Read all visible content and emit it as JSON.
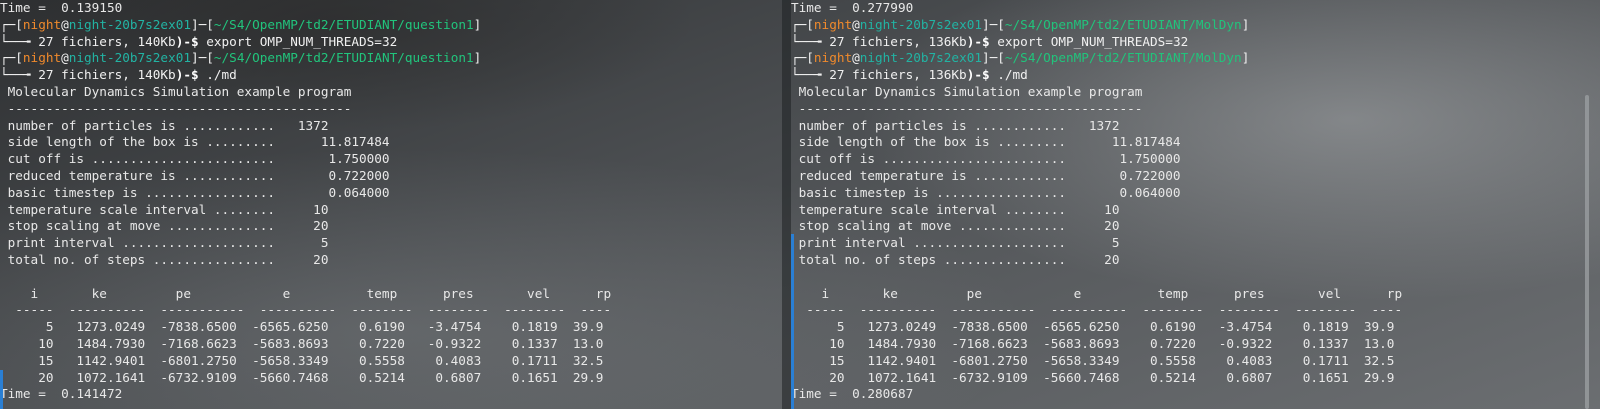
{
  "left": {
    "time_top": "Time =  0.139150",
    "prompt1": {
      "user": "night",
      "host": "night-20b7s2ex01",
      "path": "~/S4/OpenMP/td2/ETUDIANT/question1",
      "files": "27 fichiers, 140Kb",
      "cmd": " export OMP_NUM_THREADS=32"
    },
    "prompt2": {
      "user": "night",
      "host": "night-20b7s2ex01",
      "path": "~/S4/OpenMP/td2/ETUDIANT/question1",
      "files": "27 fichiers, 140Kb",
      "cmd": " ./md"
    },
    "time_bottom": "Time =  0.141472"
  },
  "right": {
    "time_top": "Time =  0.277990",
    "prompt1": {
      "user": "night",
      "host": "night-20b7s2ex01",
      "path": "~/S4/OpenMP/td2/ETUDIANT/MolDyn",
      "files": "27 fichiers, 136Kb",
      "cmd": " export OMP_NUM_THREADS=32"
    },
    "prompt2": {
      "user": "night",
      "host": "night-20b7s2ex01",
      "path": "~/S4/OpenMP/td2/ETUDIANT/MolDyn",
      "files": "27 fichiers, 136Kb",
      "cmd": " ./md"
    },
    "time_bottom": "Time =  0.280687"
  },
  "output": [
    " Molecular Dynamics Simulation example program",
    " ---------------------------------------------",
    " number of particles is ............   1372",
    " side length of the box is .........      11.817484",
    " cut off is ........................       1.750000",
    " reduced temperature is ............       0.722000",
    " basic timestep is .................       0.064000",
    " temperature scale interval ........     10",
    " stop scaling at move ..............     20",
    " print interval ....................      5",
    " total no. of steps ................     20",
    "",
    "    i       ke         pe            e          temp      pres       vel      rp",
    "  -----  ----------  -----------  ----------  --------  --------  --------  ----",
    "      5   1273.0249  -7838.6500  -6565.6250    0.6190   -3.4754    0.1819  39.9",
    "     10   1484.7930  -7168.6623  -5683.8693    0.7220   -0.9322    0.1337  13.0",
    "     15   1142.9401  -6801.2750  -5658.3349    0.5558    0.4083    0.1711  32.5",
    "     20   1072.1641  -6732.9109  -5660.7468    0.5214    0.6807    0.1651  29.9"
  ]
}
